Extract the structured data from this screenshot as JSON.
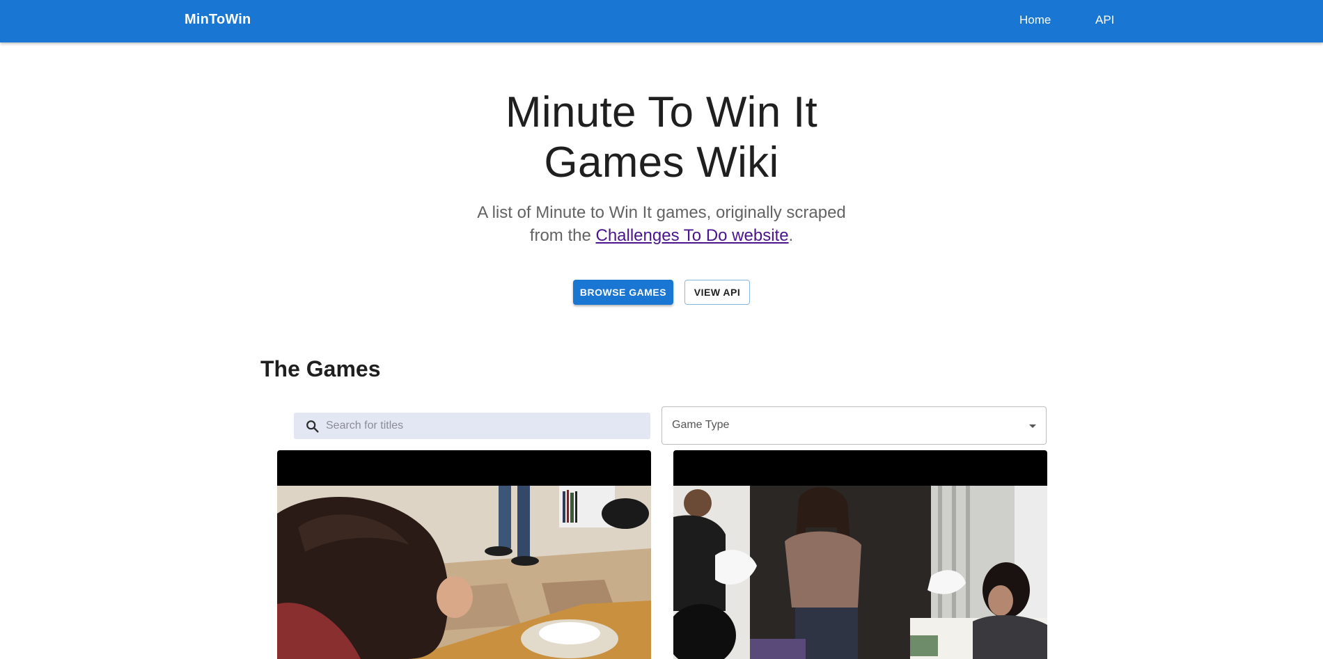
{
  "header": {
    "brand": "MinToWin",
    "nav": [
      "Home",
      "API"
    ]
  },
  "hero": {
    "title_line1": "Minute To Win It",
    "title_line2": "Games Wiki",
    "subtitle_line1": "A list of Minute to Win It games, originally scraped",
    "subtitle_line2_prefix": "from the ",
    "subtitle_link": "Challenges To Do website",
    "subtitle_line2_suffix": ".",
    "primary_button": "BROWSE GAMES",
    "secondary_button": "VIEW API"
  },
  "games": {
    "title": "The Games",
    "search_placeholder": "Search for titles",
    "filter_label": "Game Type",
    "cards": [
      {
        "image": "woman-leaning-over-bowl-photo"
      },
      {
        "image": "woman-pulling-tissues-photo"
      }
    ]
  },
  "colors": {
    "primary": "#1976d2",
    "link": "#4a148c",
    "search_bg": "#e3e6f3"
  }
}
